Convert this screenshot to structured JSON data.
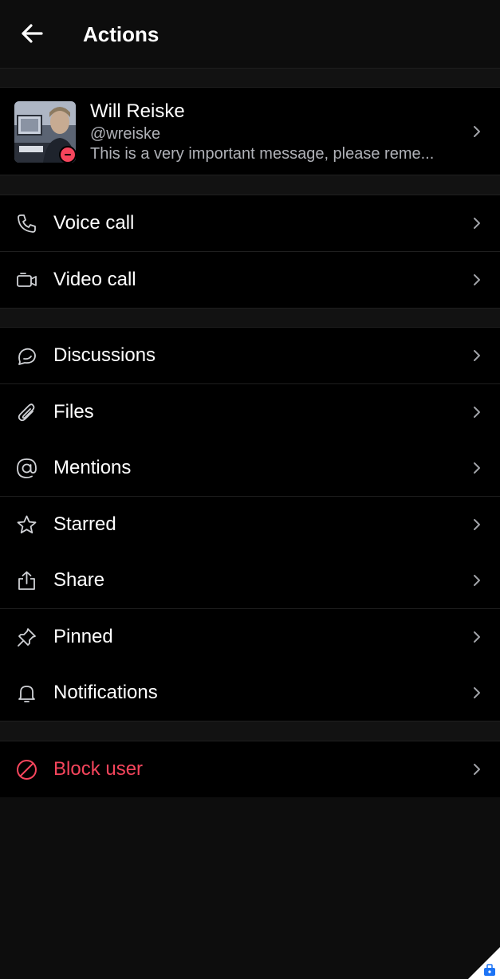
{
  "header": {
    "title": "Actions"
  },
  "profile": {
    "name": "Will Reiske",
    "handle": "@wreiske",
    "status_message": "This is a very important message, please reme..."
  },
  "sections": {
    "calls": [
      {
        "label": "Voice call",
        "icon": "phone-icon"
      },
      {
        "label": "Video call",
        "icon": "video-camera-icon"
      }
    ],
    "room": [
      {
        "label": "Discussions",
        "icon": "discussion-icon"
      },
      {
        "label": "Files",
        "icon": "paperclip-icon"
      },
      {
        "label": "Mentions",
        "icon": "at-sign-icon"
      },
      {
        "label": "Starred",
        "icon": "star-icon"
      },
      {
        "label": "Share",
        "icon": "share-icon"
      },
      {
        "label": "Pinned",
        "icon": "pin-icon"
      },
      {
        "label": "Notifications",
        "icon": "bell-icon"
      }
    ],
    "danger": [
      {
        "label": "Block user",
        "icon": "block-icon"
      }
    ]
  },
  "colors": {
    "background": "#0d0d0d",
    "row_background": "#000000",
    "text": "#ffffff",
    "secondary_text": "#b0b2b8",
    "danger": "#f5455c",
    "status_busy": "#f5455c",
    "corner_accent": "#1d74f5"
  }
}
